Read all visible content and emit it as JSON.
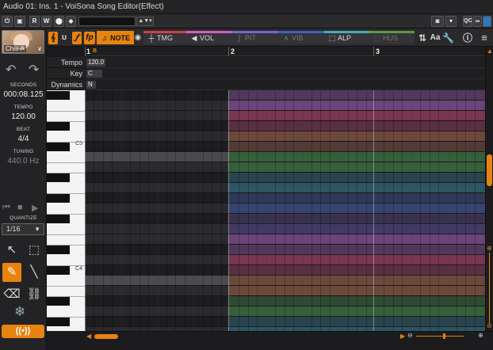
{
  "window": {
    "title": "Audio 01: Ins. 1 - VoiSona Song Editor(Effect)"
  },
  "toolbar": {
    "read_label": "R",
    "write_label": "W",
    "track_name": ""
  },
  "singer": {
    "name": "Chis-A"
  },
  "left_panel": {
    "seconds_label": "SECONDS",
    "seconds_value": "000:08.125",
    "tempo_label": "TEMPO",
    "tempo_value": "120.00",
    "beat_label": "BEAT",
    "beat_value": "4/4",
    "tuning_label": "TUNING",
    "tuning_value": "440.0 Hz",
    "quantize_label": "QUANTIZE",
    "quantize_value": "1/16"
  },
  "param_tabs": [
    {
      "label": "NOTE",
      "glyph": "𝅘𝅥𝅮",
      "color": "#e8830f",
      "active": true
    },
    {
      "label": "TMG",
      "glyph": "┼",
      "color": "#d04040"
    },
    {
      "label": "VOL",
      "glyph": "◀",
      "color": "#d060c0"
    },
    {
      "label": "PIT",
      "glyph": "∫",
      "color": "#8060d0"
    },
    {
      "label": "VIB",
      "glyph": "∧",
      "color": "#4060c0"
    },
    {
      "label": "ALP",
      "glyph": "⬚",
      "color": "#40b0b0"
    },
    {
      "label": "HUS",
      "glyph": "⬚",
      "color": "#5a9a40"
    }
  ],
  "ruler": {
    "measures": [
      "1",
      "2",
      "3"
    ],
    "marker": "B"
  },
  "tracks": {
    "tempo_label": "Tempo",
    "tempo_value": "120.0",
    "key_label": "Key",
    "key_value": "C",
    "dynamics_label": "Dynamics",
    "dynamics_value": "N"
  },
  "keyboard": {
    "c5_label": "C5",
    "c4_label": "C4"
  },
  "colors": {
    "accent": "#e8830f",
    "bands": [
      "#7a4a8a",
      "#8a3a5a",
      "#7a5040",
      "#3a6a40",
      "#2f6070",
      "#3a4a80",
      "#4a4070"
    ]
  }
}
